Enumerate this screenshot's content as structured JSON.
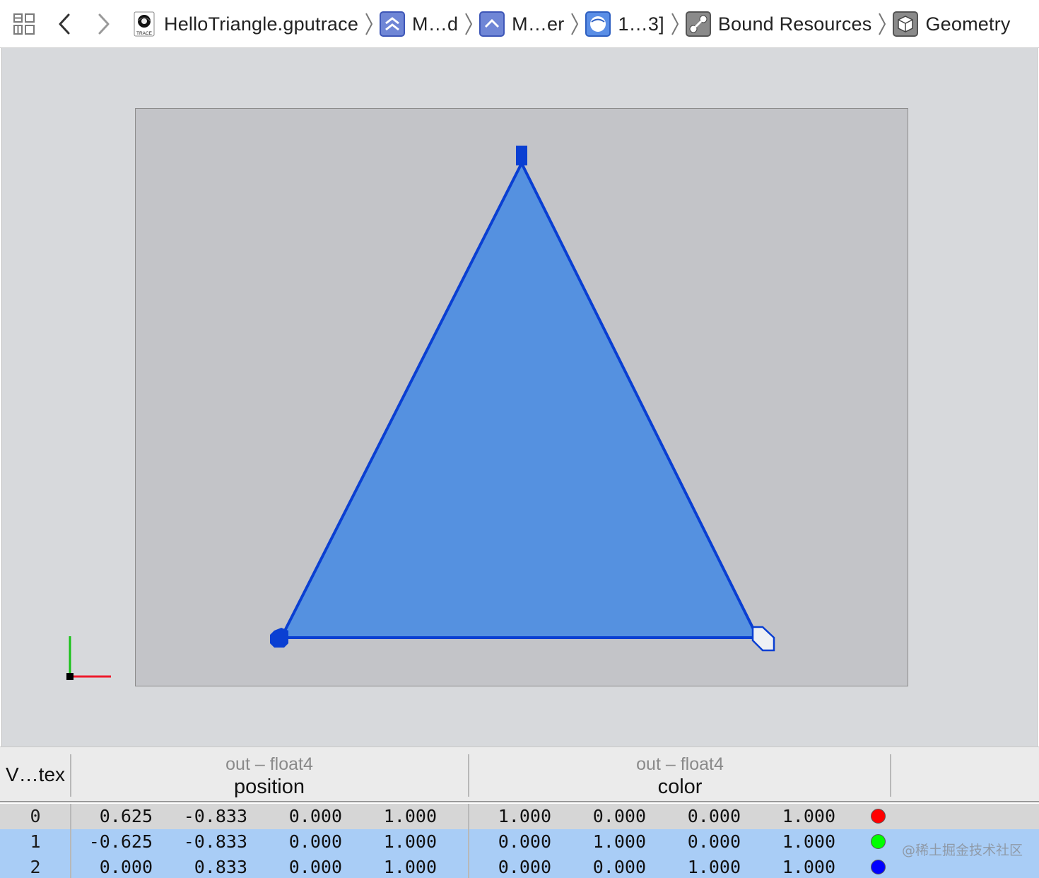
{
  "toolbar": {
    "breadcrumbs": [
      {
        "label": "HelloTriangle.gputrace",
        "icon": "gputrace-file-icon"
      },
      {
        "label": "M…d",
        "icon": "command-buffer-icon"
      },
      {
        "label": "M…er",
        "icon": "render-encoder-icon"
      },
      {
        "label": "1…3]",
        "icon": "draw-call-icon"
      },
      {
        "label": "Bound Resources",
        "icon": "bound-resources-icon"
      },
      {
        "label": "Geometry",
        "icon": "geometry-cube-icon"
      }
    ],
    "trace_badge": "TRACE"
  },
  "viewer": {
    "background": "#d7d9dc",
    "viewport_color": "#c3c4c8",
    "triangle_fill": "#5591e0",
    "triangle_stroke": "#0a3fd2"
  },
  "table": {
    "vertex_header": "V…tex",
    "groups": [
      {
        "type": "out – float4",
        "name": "position"
      },
      {
        "type": "out – float4",
        "name": "color"
      }
    ],
    "rows": [
      {
        "index": "0",
        "position": [
          "0.625",
          "-0.833",
          "0.000",
          "1.000"
        ],
        "color": [
          "1.000",
          "0.000",
          "0.000",
          "1.000"
        ],
        "swatch": "#ff0000"
      },
      {
        "index": "1",
        "position": [
          "-0.625",
          "-0.833",
          "0.000",
          "1.000"
        ],
        "color": [
          "0.000",
          "1.000",
          "0.000",
          "1.000"
        ],
        "swatch": "#00ff00"
      },
      {
        "index": "2",
        "position": [
          "0.000",
          "0.833",
          "0.000",
          "1.000"
        ],
        "color": [
          "0.000",
          "0.000",
          "1.000",
          "1.000"
        ],
        "swatch": "#0000ff"
      }
    ]
  },
  "watermark": "@稀土掘金技术社区"
}
